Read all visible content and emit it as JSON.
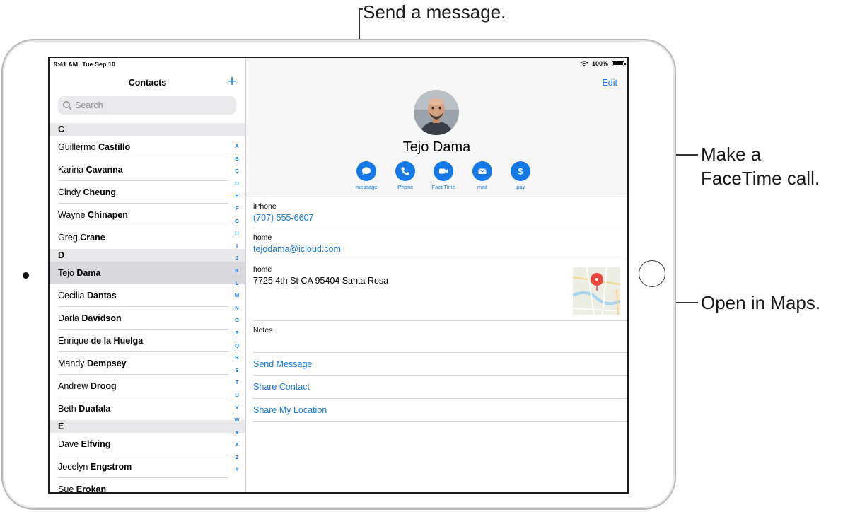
{
  "callouts": {
    "message": "Send a message.",
    "facetime_line1": "Make a",
    "facetime_line2": "FaceTime call.",
    "maps": "Open in Maps."
  },
  "status_bar": {
    "time": "9:41 AM",
    "date": "Tue Sep 10",
    "battery": "100%"
  },
  "sidebar": {
    "title": "Contacts",
    "add_label": "+",
    "search_placeholder": "Search",
    "sections": [
      {
        "letter": "C",
        "contacts": [
          {
            "first": "Guillermo",
            "last": "Castillo"
          },
          {
            "first": "Karina",
            "last": "Cavanna"
          },
          {
            "first": "Cindy",
            "last": "Cheung"
          },
          {
            "first": "Wayne",
            "last": "Chinapen"
          },
          {
            "first": "Greg",
            "last": "Crane"
          }
        ]
      },
      {
        "letter": "D",
        "contacts": [
          {
            "first": "Tejo",
            "last": "Dama"
          },
          {
            "first": "Cecilia",
            "last": "Dantas"
          },
          {
            "first": "Darla",
            "last": "Davidson"
          },
          {
            "first": "Enrique",
            "last": "de la Huelga"
          },
          {
            "first": "Mandy",
            "last": "Dempsey"
          },
          {
            "first": "Andrew",
            "last": "Droog"
          },
          {
            "first": "Beth",
            "last": "Duafala"
          }
        ]
      },
      {
        "letter": "E",
        "contacts": [
          {
            "first": "Dave",
            "last": "Elfving"
          },
          {
            "first": "Jocelyn",
            "last": "Engstrom"
          },
          {
            "first": "Sue",
            "last": "Erokan"
          }
        ]
      }
    ],
    "index_letters": [
      "A",
      "B",
      "C",
      "D",
      "E",
      "F",
      "G",
      "H",
      "I",
      "J",
      "K",
      "L",
      "M",
      "N",
      "O",
      "P",
      "Q",
      "R",
      "S",
      "T",
      "U",
      "V",
      "W",
      "X",
      "Y",
      "Z",
      "#"
    ]
  },
  "detail": {
    "edit_label": "Edit",
    "name": "Tejo Dama",
    "actions": [
      {
        "label": "message",
        "icon": "message-bubble-icon"
      },
      {
        "label": "iPhone",
        "icon": "phone-icon"
      },
      {
        "label": "FaceTime",
        "icon": "video-camera-icon"
      },
      {
        "label": "mail",
        "icon": "envelope-icon"
      },
      {
        "label": "pay",
        "icon": "dollar-icon"
      }
    ],
    "phone_label": "iPhone",
    "phone_value": "(707) 555-6607",
    "email_label": "home",
    "email_value": "tejodama@icloud.com",
    "address_label": "home",
    "address_value": "7725 4th St CA 95404 Santa Rosa",
    "notes_label": "Notes",
    "links": [
      "Send Message",
      "Share Contact",
      "Share My Location"
    ]
  },
  "colors": {
    "accent": "#1479e6",
    "map_pin": "#e8473d"
  }
}
